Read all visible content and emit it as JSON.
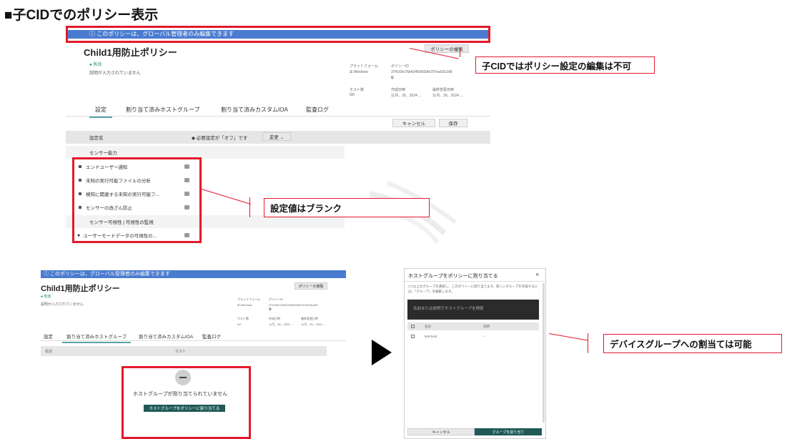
{
  "page_title": "■子CIDでのポリシー表示",
  "top": {
    "banner": "ⓘ このポリシーは、グローバル管理者のみ編集できます",
    "policy_title": "Child1用防止ポリシー",
    "status": "● 有効",
    "description": "説明が入力されていません",
    "duplicate_button": "ポリシーの複製",
    "platform_label": "プラットフォーム",
    "platform_value": "Windows",
    "policy_id_label": "ポリシーID",
    "policy_id_value": "374169c76b424f3d92dfa797ea93c2d5",
    "host_count_label": "ホスト数",
    "host_count_value": "0/0",
    "created_label": "作成日時",
    "created_value": "11月、26、2024 ...",
    "modified_label": "最終変更日時",
    "modified_value": "11月、26、2024 ...",
    "tabs": [
      "設定",
      "割り当て済みホストグループ",
      "割り当て済みカスタムIOA",
      "監査ログ"
    ],
    "cancel_button": "キャンセル",
    "save_button": "保存",
    "setting_name_header": "設定名",
    "filter_note": "◆ 必要設定が「オフ」です",
    "change_dropdown": "変更 ⌄",
    "section1": "センサー能力",
    "rows": [
      "エンドユーザー通知",
      "未知の実行可能ファイルの分析",
      "検知に関連する未知の実行可能フ...",
      "センサーの改ざん防止"
    ],
    "section2": "センサー可視性 | 可視性の監視",
    "row_last": "ユーザーモードデータの可視性の...",
    "callout_edit": "子CIDではポリシー設定の編集は不可",
    "callout_blank": "設定値はブランク"
  },
  "bottom_left": {
    "banner": "ⓘ このポリシーは、グローバル管理者のみ編集できます",
    "policy_title": "Child1用防止ポリシー",
    "status": "● 有効",
    "description": "説明が入力されていません",
    "duplicate_button": "ポリシーの複製",
    "platform_label": "プラットフォーム",
    "platform_value": "Windows",
    "policy_id_label": "ポリシーID",
    "policy_id_value": "374169c76b424f3d92dfa797ea93c2d5",
    "host_count_label": "ホスト数",
    "host_count_value": "0/0",
    "created_label": "作成日時",
    "created_value": "11月、26、2024 ...",
    "modified_label": "最終変更日時",
    "modified_value": "11月、26、2024 ...",
    "tabs": [
      "設定",
      "割り当て済みホストグループ",
      "割り当て済みカスタムIOA",
      "監査ログ"
    ],
    "col_name": "名前",
    "col_host": "ホスト",
    "empty_text": "ホストグループが割り当てられていません",
    "assign_button": "ホストグループをポリシーに割り当てる"
  },
  "dialog": {
    "title": "ホストグループをポリシーに割り当てる",
    "close": "×",
    "desc": "1つ以上のグループを選択し、このポリシーに割り当てます。新しいグループを作成するには、「グループ」を編集します。",
    "search_placeholder": "名前または説明でホストグループを検索",
    "col_name": "名前",
    "col_type": "説明",
    "row_name": "test-host",
    "row_type": "--",
    "cancel_button": "キャンセル",
    "assign_button": "グループを割り当て",
    "callout": "デバイスグループへの割当ては可能"
  }
}
